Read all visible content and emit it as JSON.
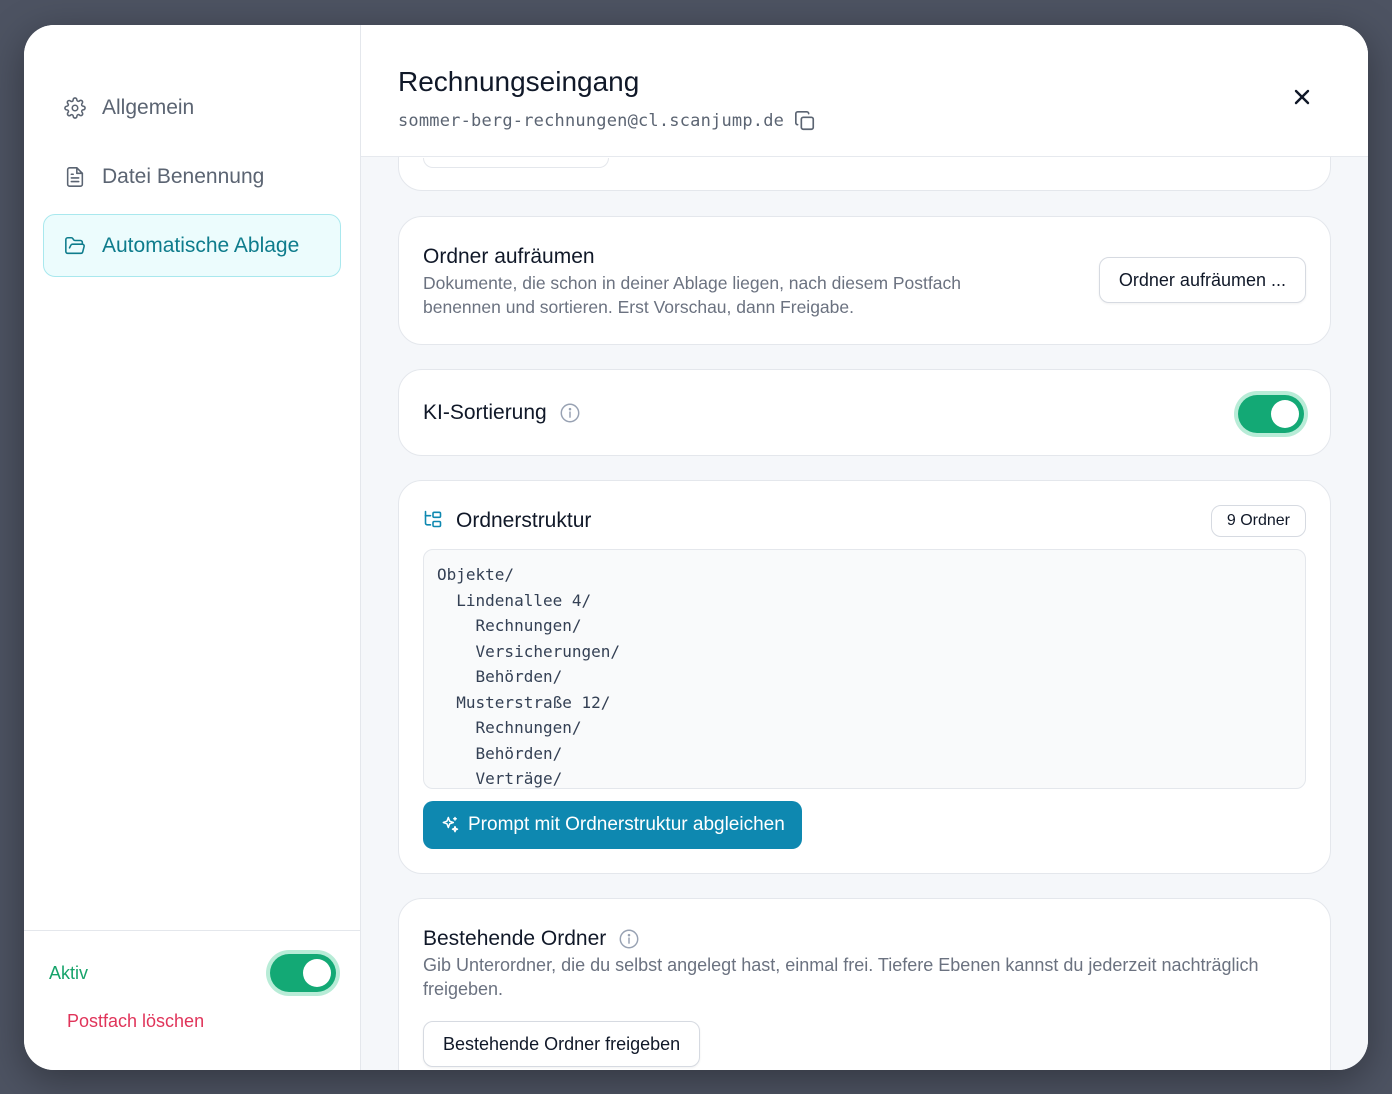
{
  "sidebar": {
    "items": [
      {
        "label": "Allgemein",
        "icon": "gear-icon"
      },
      {
        "label": "Datei Benennung",
        "icon": "document-icon"
      },
      {
        "label": "Automatische Ablage",
        "icon": "folder-open-icon",
        "active": true
      }
    ],
    "footer": {
      "active_label": "Aktiv",
      "active_on": true,
      "delete_label": "Postfach löschen"
    }
  },
  "header": {
    "title": "Rechnungseingang",
    "email": "sommer-berg-rechnungen@cl.scanjump.de"
  },
  "cleanup": {
    "title": "Ordner aufräumen",
    "description": "Dokumente, die schon in deiner Ablage liegen, nach diesem Postfach benennen und sortieren. Erst Vorschau, dann Freigabe.",
    "button": "Ordner aufräumen ..."
  },
  "ki": {
    "title": "KI-Sortierung",
    "enabled": true
  },
  "structure": {
    "title": "Ordnerstruktur",
    "badge": "9 Ordner",
    "tree": [
      "Objekte/",
      "  Lindenallee 4/",
      "    Rechnungen/",
      "    Versicherungen/",
      "    Behörden/",
      "  Musterstraße 12/",
      "    Rechnungen/",
      "    Behörden/",
      "    Verträge/"
    ],
    "button": "Prompt mit Ordnerstruktur abgleichen"
  },
  "existing": {
    "title": "Bestehende Ordner",
    "description": "Gib Unterordner, die du selbst angelegt hast, einmal frei. Tiefere Ebenen kannst du jederzeit nachträglich freigeben.",
    "button": "Bestehende Ordner freigeben"
  },
  "colors": {
    "accent": "#0e88b0",
    "active_nav": "#0e7c8c",
    "toggle_on": "#13a975",
    "danger": "#e0345a"
  }
}
